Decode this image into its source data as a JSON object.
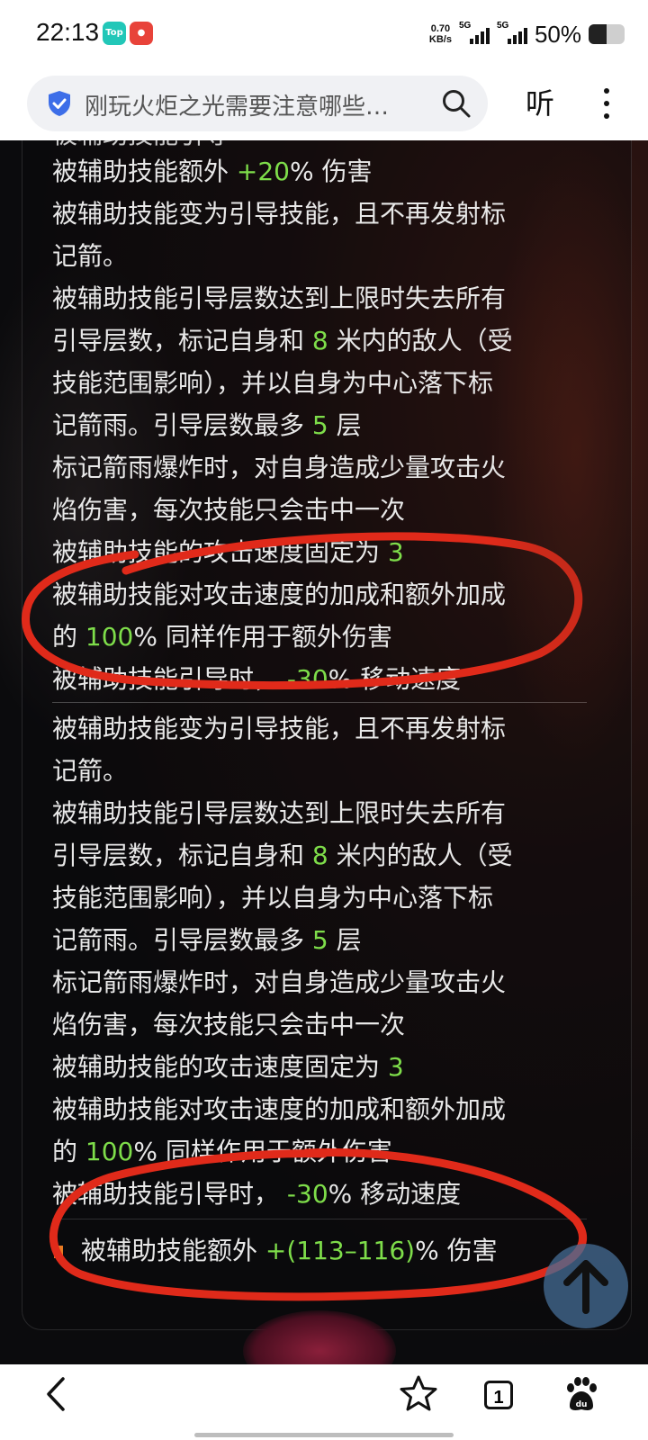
{
  "status_bar": {
    "time": "22:13",
    "net_speed_value": "0.70",
    "net_speed_unit": "KB/s",
    "signal1_label": "5G",
    "signal2_label": "5G",
    "battery": "50%",
    "battery_level": 0.5,
    "app_badge_1": "Top"
  },
  "search": {
    "query": "刚玩火炬之光需要注意哪些…"
  },
  "toolbar": {
    "listen_label": "听"
  },
  "colors": {
    "highlight": "#7edd4a",
    "text": "#e8e8e8",
    "annotation": "#e02a1a"
  },
  "section1": {
    "lines": [
      [
        "被辅助技能额外 ",
        "+20",
        "% 伤害"
      ],
      [
        "被辅助技能变为引导技能，且不再发射标",
        "",
        ""
      ],
      [
        "记箭。",
        "",
        ""
      ],
      [
        "被辅助技能引导层数达到上限时失去所有",
        "",
        ""
      ],
      [
        "引导层数，标记自身和 ",
        "8",
        " 米内的敌人（受"
      ],
      [
        "技能范围影响），并以自身为中心落下标",
        "",
        ""
      ],
      [
        "记箭雨。引导层数最多 ",
        "5",
        " 层"
      ],
      [
        "标记箭雨爆炸时，对自身造成少量攻击火",
        "",
        ""
      ],
      [
        "焰伤害，每次技能只会击中一次",
        "",
        ""
      ],
      [
        "被辅助技能的攻击速度固定为 ",
        "3",
        ""
      ],
      [
        "被辅助技能对攻击速度的加成和额外加成",
        "",
        ""
      ],
      [
        "的 ",
        "100",
        "% 同样作用于额外伤害"
      ],
      [
        "被辅助技能引导时， ",
        "-30",
        "% 移动速度"
      ]
    ]
  },
  "section2": {
    "lines": [
      [
        "被辅助技能变为引导技能，且不再发射标",
        "",
        ""
      ],
      [
        "记箭。",
        "",
        ""
      ],
      [
        "被辅助技能引导层数达到上限时失去所有",
        "",
        ""
      ],
      [
        "引导层数，标记自身和 ",
        "8",
        " 米内的敌人（受"
      ],
      [
        "技能范围影响），并以自身为中心落下标",
        "",
        ""
      ],
      [
        "记箭雨。引导层数最多 ",
        "5",
        " 层"
      ],
      [
        "标记箭雨爆炸时，对自身造成少量攻击火",
        "",
        ""
      ],
      [
        "焰伤害，每次技能只会击中一次",
        "",
        ""
      ],
      [
        "被辅助技能的攻击速度固定为 ",
        "3",
        ""
      ],
      [
        "被辅助技能对攻击速度的加成和额外加成",
        "",
        ""
      ],
      [
        "的 ",
        "100",
        "% 同样作用于额外伤害"
      ],
      [
        "被辅助技能引导时， ",
        "-30",
        "% 移动速度"
      ]
    ]
  },
  "affix": {
    "prefix": "被辅助技能额外 ",
    "value": "+(113–116)",
    "suffix": "% 伤害"
  },
  "bottom_nav": {
    "tab_count": "1"
  }
}
